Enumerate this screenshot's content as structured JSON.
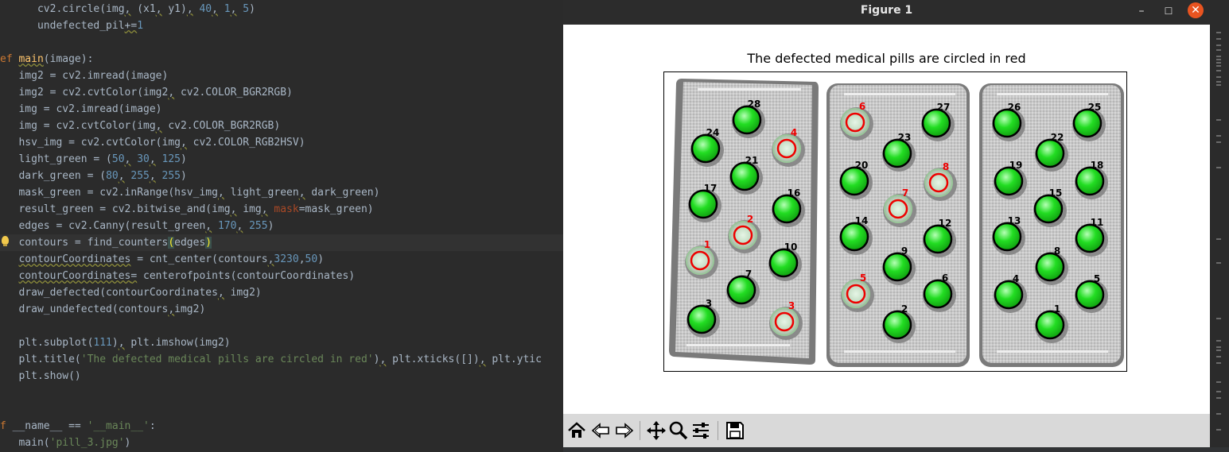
{
  "editor": {
    "lines": [
      {
        "indent": "      ",
        "parts": [
          {
            "t": "cv2.circle(img",
            "c": ""
          },
          {
            "t": ",",
            "c": "wavy"
          },
          {
            "t": " (x1",
            "c": ""
          },
          {
            "t": ",",
            "c": "wavy"
          },
          {
            "t": " y1)",
            "c": ""
          },
          {
            "t": ",",
            "c": "wavy"
          },
          {
            "t": " ",
            "c": ""
          },
          {
            "t": "40",
            "c": "num"
          },
          {
            "t": ",",
            "c": "wavy"
          },
          {
            "t": " ",
            "c": ""
          },
          {
            "t": "1",
            "c": "num"
          },
          {
            "t": ",",
            "c": "wavy"
          },
          {
            "t": " ",
            "c": ""
          },
          {
            "t": "5",
            "c": "num"
          },
          {
            "t": ")",
            "c": ""
          }
        ]
      },
      {
        "indent": "      ",
        "parts": [
          {
            "t": "undefected_pil",
            "c": ""
          },
          {
            "t": "+=",
            "c": "wavy"
          },
          {
            "t": "1",
            "c": "num"
          }
        ]
      },
      {
        "indent": "",
        "parts": []
      },
      {
        "indent": "",
        "parts": [
          {
            "t": "ef ",
            "c": "kw"
          },
          {
            "t": "main",
            "c": "fn wavy"
          },
          {
            "t": "(image):",
            "c": ""
          }
        ]
      },
      {
        "indent": "   ",
        "parts": [
          {
            "t": "img2 = cv2.imread(image)",
            "c": ""
          }
        ]
      },
      {
        "indent": "   ",
        "parts": [
          {
            "t": "img2 = cv2.cvtColor(img2",
            "c": ""
          },
          {
            "t": ",",
            "c": "wavy"
          },
          {
            "t": " cv2.COLOR_BGR2RGB)",
            "c": ""
          }
        ]
      },
      {
        "indent": "   ",
        "parts": [
          {
            "t": "img = cv2.imread(image)",
            "c": ""
          }
        ]
      },
      {
        "indent": "   ",
        "parts": [
          {
            "t": "img = cv2.cvtColor(img",
            "c": ""
          },
          {
            "t": ",",
            "c": "wavy"
          },
          {
            "t": " cv2.COLOR_BGR2RGB)",
            "c": ""
          }
        ]
      },
      {
        "indent": "   ",
        "parts": [
          {
            "t": "hsv_img = cv2.cvtColor(img",
            "c": ""
          },
          {
            "t": ",",
            "c": "wavy"
          },
          {
            "t": " cv2.COLOR_RGB2HSV)",
            "c": ""
          }
        ]
      },
      {
        "indent": "   ",
        "parts": [
          {
            "t": "light_green = (",
            "c": ""
          },
          {
            "t": "50",
            "c": "num"
          },
          {
            "t": ",",
            "c": "wavy"
          },
          {
            "t": " ",
            "c": ""
          },
          {
            "t": "30",
            "c": "num"
          },
          {
            "t": ",",
            "c": "wavy"
          },
          {
            "t": " ",
            "c": ""
          },
          {
            "t": "125",
            "c": "num"
          },
          {
            "t": ")",
            "c": ""
          }
        ]
      },
      {
        "indent": "   ",
        "parts": [
          {
            "t": "dark_green = (",
            "c": ""
          },
          {
            "t": "80",
            "c": "num"
          },
          {
            "t": ",",
            "c": "wavy"
          },
          {
            "t": " ",
            "c": ""
          },
          {
            "t": "255",
            "c": "num"
          },
          {
            "t": ",",
            "c": "wavy"
          },
          {
            "t": " ",
            "c": ""
          },
          {
            "t": "255",
            "c": "num"
          },
          {
            "t": ")",
            "c": ""
          }
        ]
      },
      {
        "indent": "   ",
        "parts": [
          {
            "t": "mask_green = cv2.inRange(hsv_img",
            "c": ""
          },
          {
            "t": ",",
            "c": "wavy"
          },
          {
            "t": " light_green",
            "c": ""
          },
          {
            "t": ",",
            "c": "wavy"
          },
          {
            "t": " dark_green)",
            "c": ""
          }
        ]
      },
      {
        "indent": "   ",
        "parts": [
          {
            "t": "result_green = cv2.bitwise_and(img",
            "c": ""
          },
          {
            "t": ",",
            "c": "wavy"
          },
          {
            "t": " img",
            "c": ""
          },
          {
            "t": ",",
            "c": "wavy"
          },
          {
            "t": " ",
            "c": ""
          },
          {
            "t": "mask",
            "c": "kwarg"
          },
          {
            "t": "=mask_green)",
            "c": ""
          }
        ]
      },
      {
        "indent": "   ",
        "parts": [
          {
            "t": "edges = cv2.Canny(result_green",
            "c": ""
          },
          {
            "t": ",",
            "c": "wavy"
          },
          {
            "t": " ",
            "c": ""
          },
          {
            "t": "170",
            "c": "num"
          },
          {
            "t": ",",
            "c": "wavy"
          },
          {
            "t": " ",
            "c": ""
          },
          {
            "t": "255",
            "c": "num"
          },
          {
            "t": ")",
            "c": ""
          }
        ]
      },
      {
        "indent": "   ",
        "parts": [
          {
            "t": "contours = find_counters",
            "c": ""
          },
          {
            "t": "(",
            "c": "brace"
          },
          {
            "t": "edges",
            "c": ""
          },
          {
            "t": ")",
            "c": "brace"
          }
        ]
      },
      {
        "indent": "   ",
        "parts": [
          {
            "t": "contourCoordinates",
            "c": "wavy"
          },
          {
            "t": " = cnt_center(contours",
            "c": ""
          },
          {
            "t": ",",
            "c": "wavy"
          },
          {
            "t": "3230",
            "c": "num"
          },
          {
            "t": ",",
            "c": ""
          },
          {
            "t": "50",
            "c": "num"
          },
          {
            "t": ")",
            "c": ""
          }
        ]
      },
      {
        "indent": "   ",
        "parts": [
          {
            "t": "contourCoordinates",
            "c": "wavy"
          },
          {
            "t": "=",
            "c": "wavy"
          },
          {
            "t": " centerofpoints(contourCoordinates)",
            "c": ""
          }
        ]
      },
      {
        "indent": "   ",
        "parts": [
          {
            "t": "draw_defected(contourCoordinates",
            "c": ""
          },
          {
            "t": ",",
            "c": "wavy"
          },
          {
            "t": " img2)",
            "c": ""
          }
        ]
      },
      {
        "indent": "   ",
        "parts": [
          {
            "t": "draw_undefected(contours",
            "c": ""
          },
          {
            "t": ",",
            "c": "wavy"
          },
          {
            "t": "img2)",
            "c": ""
          }
        ]
      },
      {
        "indent": "",
        "parts": []
      },
      {
        "indent": "   ",
        "parts": [
          {
            "t": "plt.subplot(",
            "c": ""
          },
          {
            "t": "111",
            "c": "num"
          },
          {
            "t": ")",
            "c": ""
          },
          {
            "t": ",",
            "c": "wavy"
          },
          {
            "t": " plt.imshow(img2)",
            "c": ""
          }
        ]
      },
      {
        "indent": "   ",
        "parts": [
          {
            "t": "plt.title(",
            "c": ""
          },
          {
            "t": "'The defected medical pills are circled in red'",
            "c": "str"
          },
          {
            "t": ")",
            "c": ""
          },
          {
            "t": ",",
            "c": "wavy"
          },
          {
            "t": " plt.xticks([])",
            "c": ""
          },
          {
            "t": ",",
            "c": "wavy"
          },
          {
            "t": " plt.ytic",
            "c": ""
          }
        ]
      },
      {
        "indent": "   ",
        "parts": [
          {
            "t": "plt.show()",
            "c": ""
          }
        ]
      },
      {
        "indent": "",
        "parts": []
      },
      {
        "indent": "",
        "parts": []
      },
      {
        "indent": "",
        "parts": [
          {
            "t": "f ",
            "c": "kw"
          },
          {
            "t": "__name__ == ",
            "c": ""
          },
          {
            "t": "'__main__'",
            "c": "str"
          },
          {
            "t": ":",
            "c": ""
          }
        ]
      },
      {
        "indent": "   ",
        "parts": [
          {
            "t": "main(",
            "c": ""
          },
          {
            "t": "'pill_3.jpg'",
            "c": "str"
          },
          {
            "t": ")",
            "c": ""
          }
        ]
      }
    ]
  },
  "window": {
    "title": "Figure 1",
    "minimize": "–",
    "maximize": "☐",
    "close": "✕"
  },
  "plot": {
    "title": "The defected medical pills are circled in red"
  },
  "pills": [
    {
      "label": "28",
      "defected": false
    },
    {
      "label": "24",
      "defected": false
    },
    {
      "label": "4",
      "defected": true
    },
    {
      "label": "21",
      "defected": false
    },
    {
      "label": "17",
      "defected": false
    },
    {
      "label": "16",
      "defected": false
    },
    {
      "label": "2",
      "defected": true
    },
    {
      "label": "1",
      "defected": true
    },
    {
      "label": "10",
      "defected": false
    },
    {
      "label": "7",
      "defected": false
    },
    {
      "label": "3",
      "defected": false
    },
    {
      "label": "3",
      "defected": true
    },
    {
      "label": "6",
      "defected": true
    },
    {
      "label": "27",
      "defected": false
    },
    {
      "label": "23",
      "defected": false
    },
    {
      "label": "20",
      "defected": false
    },
    {
      "label": "8",
      "defected": true
    },
    {
      "label": "7",
      "defected": true
    },
    {
      "label": "14",
      "defected": false
    },
    {
      "label": "12",
      "defected": false
    },
    {
      "label": "9",
      "defected": false
    },
    {
      "label": "5",
      "defected": true
    },
    {
      "label": "6",
      "defected": false
    },
    {
      "label": "2",
      "defected": false
    },
    {
      "label": "26",
      "defected": false
    },
    {
      "label": "25",
      "defected": false
    },
    {
      "label": "22",
      "defected": false
    },
    {
      "label": "19",
      "defected": false
    },
    {
      "label": "18",
      "defected": false
    },
    {
      "label": "15",
      "defected": false
    },
    {
      "label": "13",
      "defected": false
    },
    {
      "label": "11",
      "defected": false
    },
    {
      "label": "8",
      "defected": false
    },
    {
      "label": "4",
      "defected": false
    },
    {
      "label": "5",
      "defected": false
    },
    {
      "label": "1",
      "defected": false
    }
  ],
  "toolbar": {
    "buttons": [
      "home-icon",
      "back-icon",
      "forward-icon",
      "pan-icon",
      "zoom-icon",
      "configure-subplots-icon",
      "save-icon"
    ]
  },
  "colors": {
    "pill_green": "#22dd22",
    "defect_red": "#ee0000",
    "editor_bg": "#2b2b2b"
  }
}
